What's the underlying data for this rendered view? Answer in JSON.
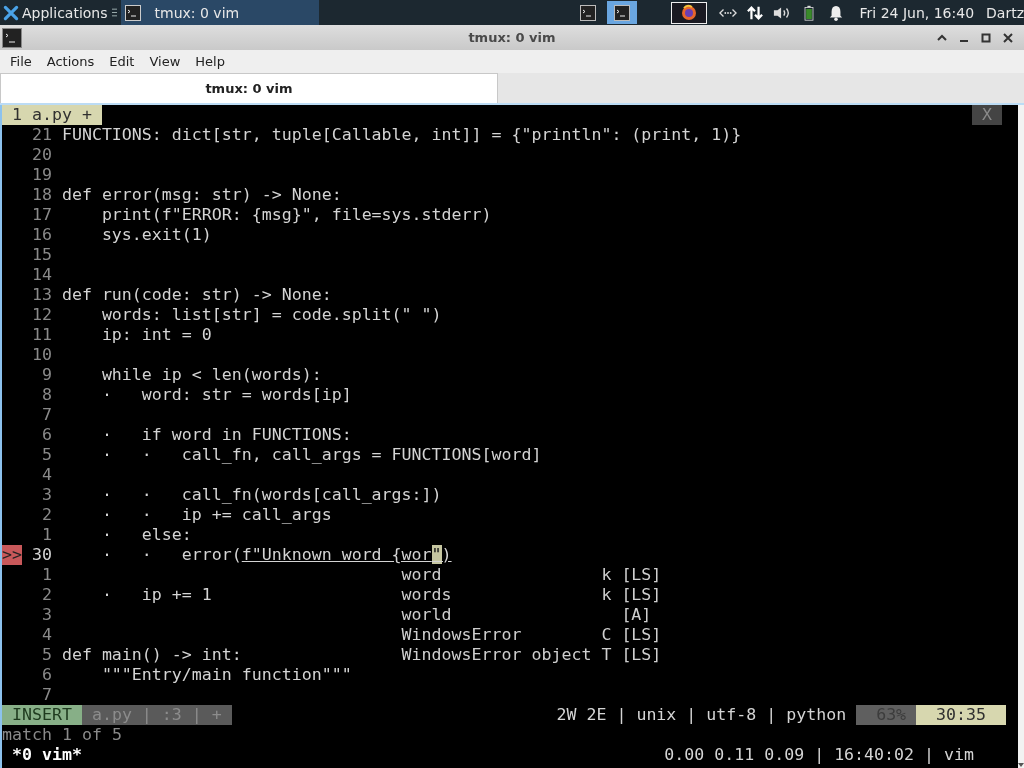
{
  "panel": {
    "menu_label": "Applications",
    "tasks": [
      {
        "label": "tmux: 0 vim",
        "selected": true
      }
    ],
    "workspaces": [
      {
        "selected": false
      },
      {
        "selected": true
      }
    ],
    "clock": "Fri 24 Jun, 16:40",
    "user": "Dartz"
  },
  "window": {
    "title": "tmux: 0 vim"
  },
  "menu_bar": [
    "File",
    "Actions",
    "Edit",
    "View",
    "Help"
  ],
  "tabs": [
    {
      "label": "tmux: 0 vim",
      "selected": true
    }
  ],
  "vim": {
    "buffer_tab": "1 a.py +",
    "close_label": "X",
    "lines": [
      {
        "number": "21",
        "text": "FUNCTIONS: dict[str, tuple[Callable, int]] = {\"println\": (print, 1)}"
      },
      {
        "number": "20"
      },
      {
        "number": "19"
      },
      {
        "number": "18",
        "text": "def error(msg: str) -> None:"
      },
      {
        "number": "17",
        "text": "    print(f\"ERROR: {msg}\", file=sys.stderr)"
      },
      {
        "number": "16",
        "text": "    sys.exit(1)"
      },
      {
        "number": "15"
      },
      {
        "number": "14"
      },
      {
        "number": "13",
        "text": "def run(code: str) -> None:"
      },
      {
        "number": "12",
        "text": "    words: list[str] = code.split(\" \")"
      },
      {
        "number": "11",
        "text": "    ip: int = 0"
      },
      {
        "number": "10"
      },
      {
        "number": "9",
        "text": "    while ip < len(words):"
      },
      {
        "number": "8",
        "text": "    ·   word: str = words[ip]"
      },
      {
        "number": "7"
      },
      {
        "number": "6",
        "text": "    ·   if word in FUNCTIONS:"
      },
      {
        "number": "5",
        "text": "    ·   ·   call_fn, call_args = FUNCTIONS[word]"
      },
      {
        "number": "4"
      },
      {
        "number": "3",
        "text": "    ·   ·   call_fn(words[call_args:])"
      },
      {
        "number": "2",
        "text": "    ·   ·   ip += call_args"
      },
      {
        "number": "1",
        "text": "    ·   else:"
      },
      {
        "number": "30",
        "sign": ">>",
        "text": "    ·   ·   error(",
        "underlined": "f\"Unknown word {wor",
        "cursor": "\"",
        "after": ")"
      },
      {
        "number": "1"
      },
      {
        "number": "2",
        "text": "    ·   ip += 1"
      },
      {
        "number": "3"
      },
      {
        "number": "4"
      },
      {
        "number": "5",
        "text": "def main() -> int:"
      },
      {
        "number": "6",
        "text": "    \"\"\"Entry/main function\"\"\""
      },
      {
        "number": "7"
      }
    ],
    "completion": [
      {
        "word": "word",
        "kind": "k",
        "source": "[LS]"
      },
      {
        "word": "words",
        "kind": "k",
        "source": "[LS]"
      },
      {
        "word": "world",
        "source": "[A]"
      },
      {
        "word": "WindowsError",
        "kind": "C",
        "source": "[LS]"
      },
      {
        "word": "WindowsError object",
        "kind": "T",
        "source": "[LS]"
      }
    ],
    "statusline": {
      "mode": "INSERT",
      "file": "a.py | :3 | +",
      "info": "2W 2E | unix | utf-8 | python",
      "percent": "63%",
      "position": "30:35"
    },
    "message": "match 1 of 5"
  },
  "tmux": {
    "window": "*0 vim*",
    "status": "0.00 0.11 0.09 | 16:40:02 | vim"
  }
}
